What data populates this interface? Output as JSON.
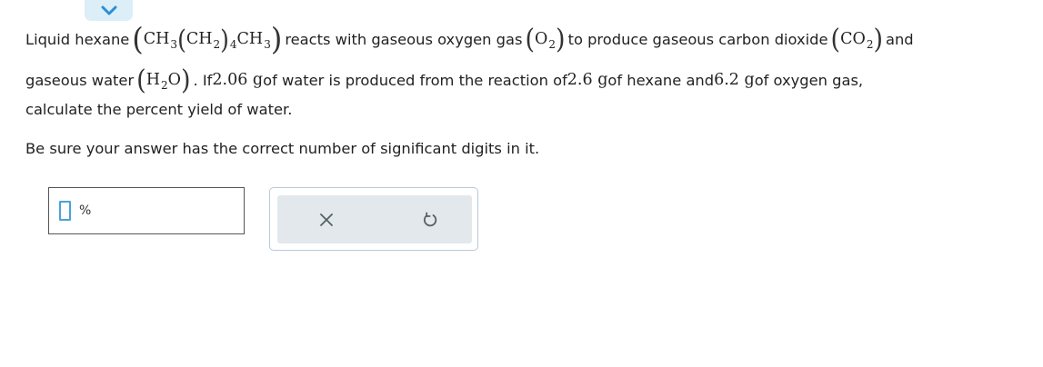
{
  "question": {
    "line1": {
      "t1": "Liquid hexane ",
      "hexane_a": "CH",
      "hexane_a_sub": "3",
      "hexane_b": "CH",
      "hexane_b_sub": "2",
      "hexane_b_outer_sub": "4",
      "hexane_c": "CH",
      "hexane_c_sub": "3",
      "t2": " reacts with gaseous oxygen gas ",
      "oxygen": "O",
      "oxygen_sub": "2",
      "t3": " to produce gaseous carbon dioxide ",
      "co2": "CO",
      "co2_sub": "2",
      "t4": " and"
    },
    "line2": {
      "t1": "gaseous water ",
      "water_h": "H",
      "water_h_sub": "2",
      "water_o": "O",
      "t2": ". If ",
      "water_mass": "2.06 g",
      "t3": " of water is produced from the reaction of ",
      "hexane_mass": "2.6 g",
      "t4": " of hexane and ",
      "oxygen_mass": "6.2 g",
      "t5": " of oxygen gas,"
    },
    "line3": "calculate the percent yield of water.",
    "instruction": "Be sure your answer has the correct number of significant digits in it."
  },
  "answer": {
    "value": "",
    "unit": "%"
  },
  "toolbar": {
    "clear_icon": "x-icon",
    "undo_icon": "undo-icon"
  },
  "colors": {
    "collapse_tab_bg": "#dceef7",
    "collapse_arrow": "#2b8fd6",
    "caret": "#4aa3d8",
    "tool_bg": "#e2e8ec",
    "tool_border": "#b9c9d6"
  }
}
